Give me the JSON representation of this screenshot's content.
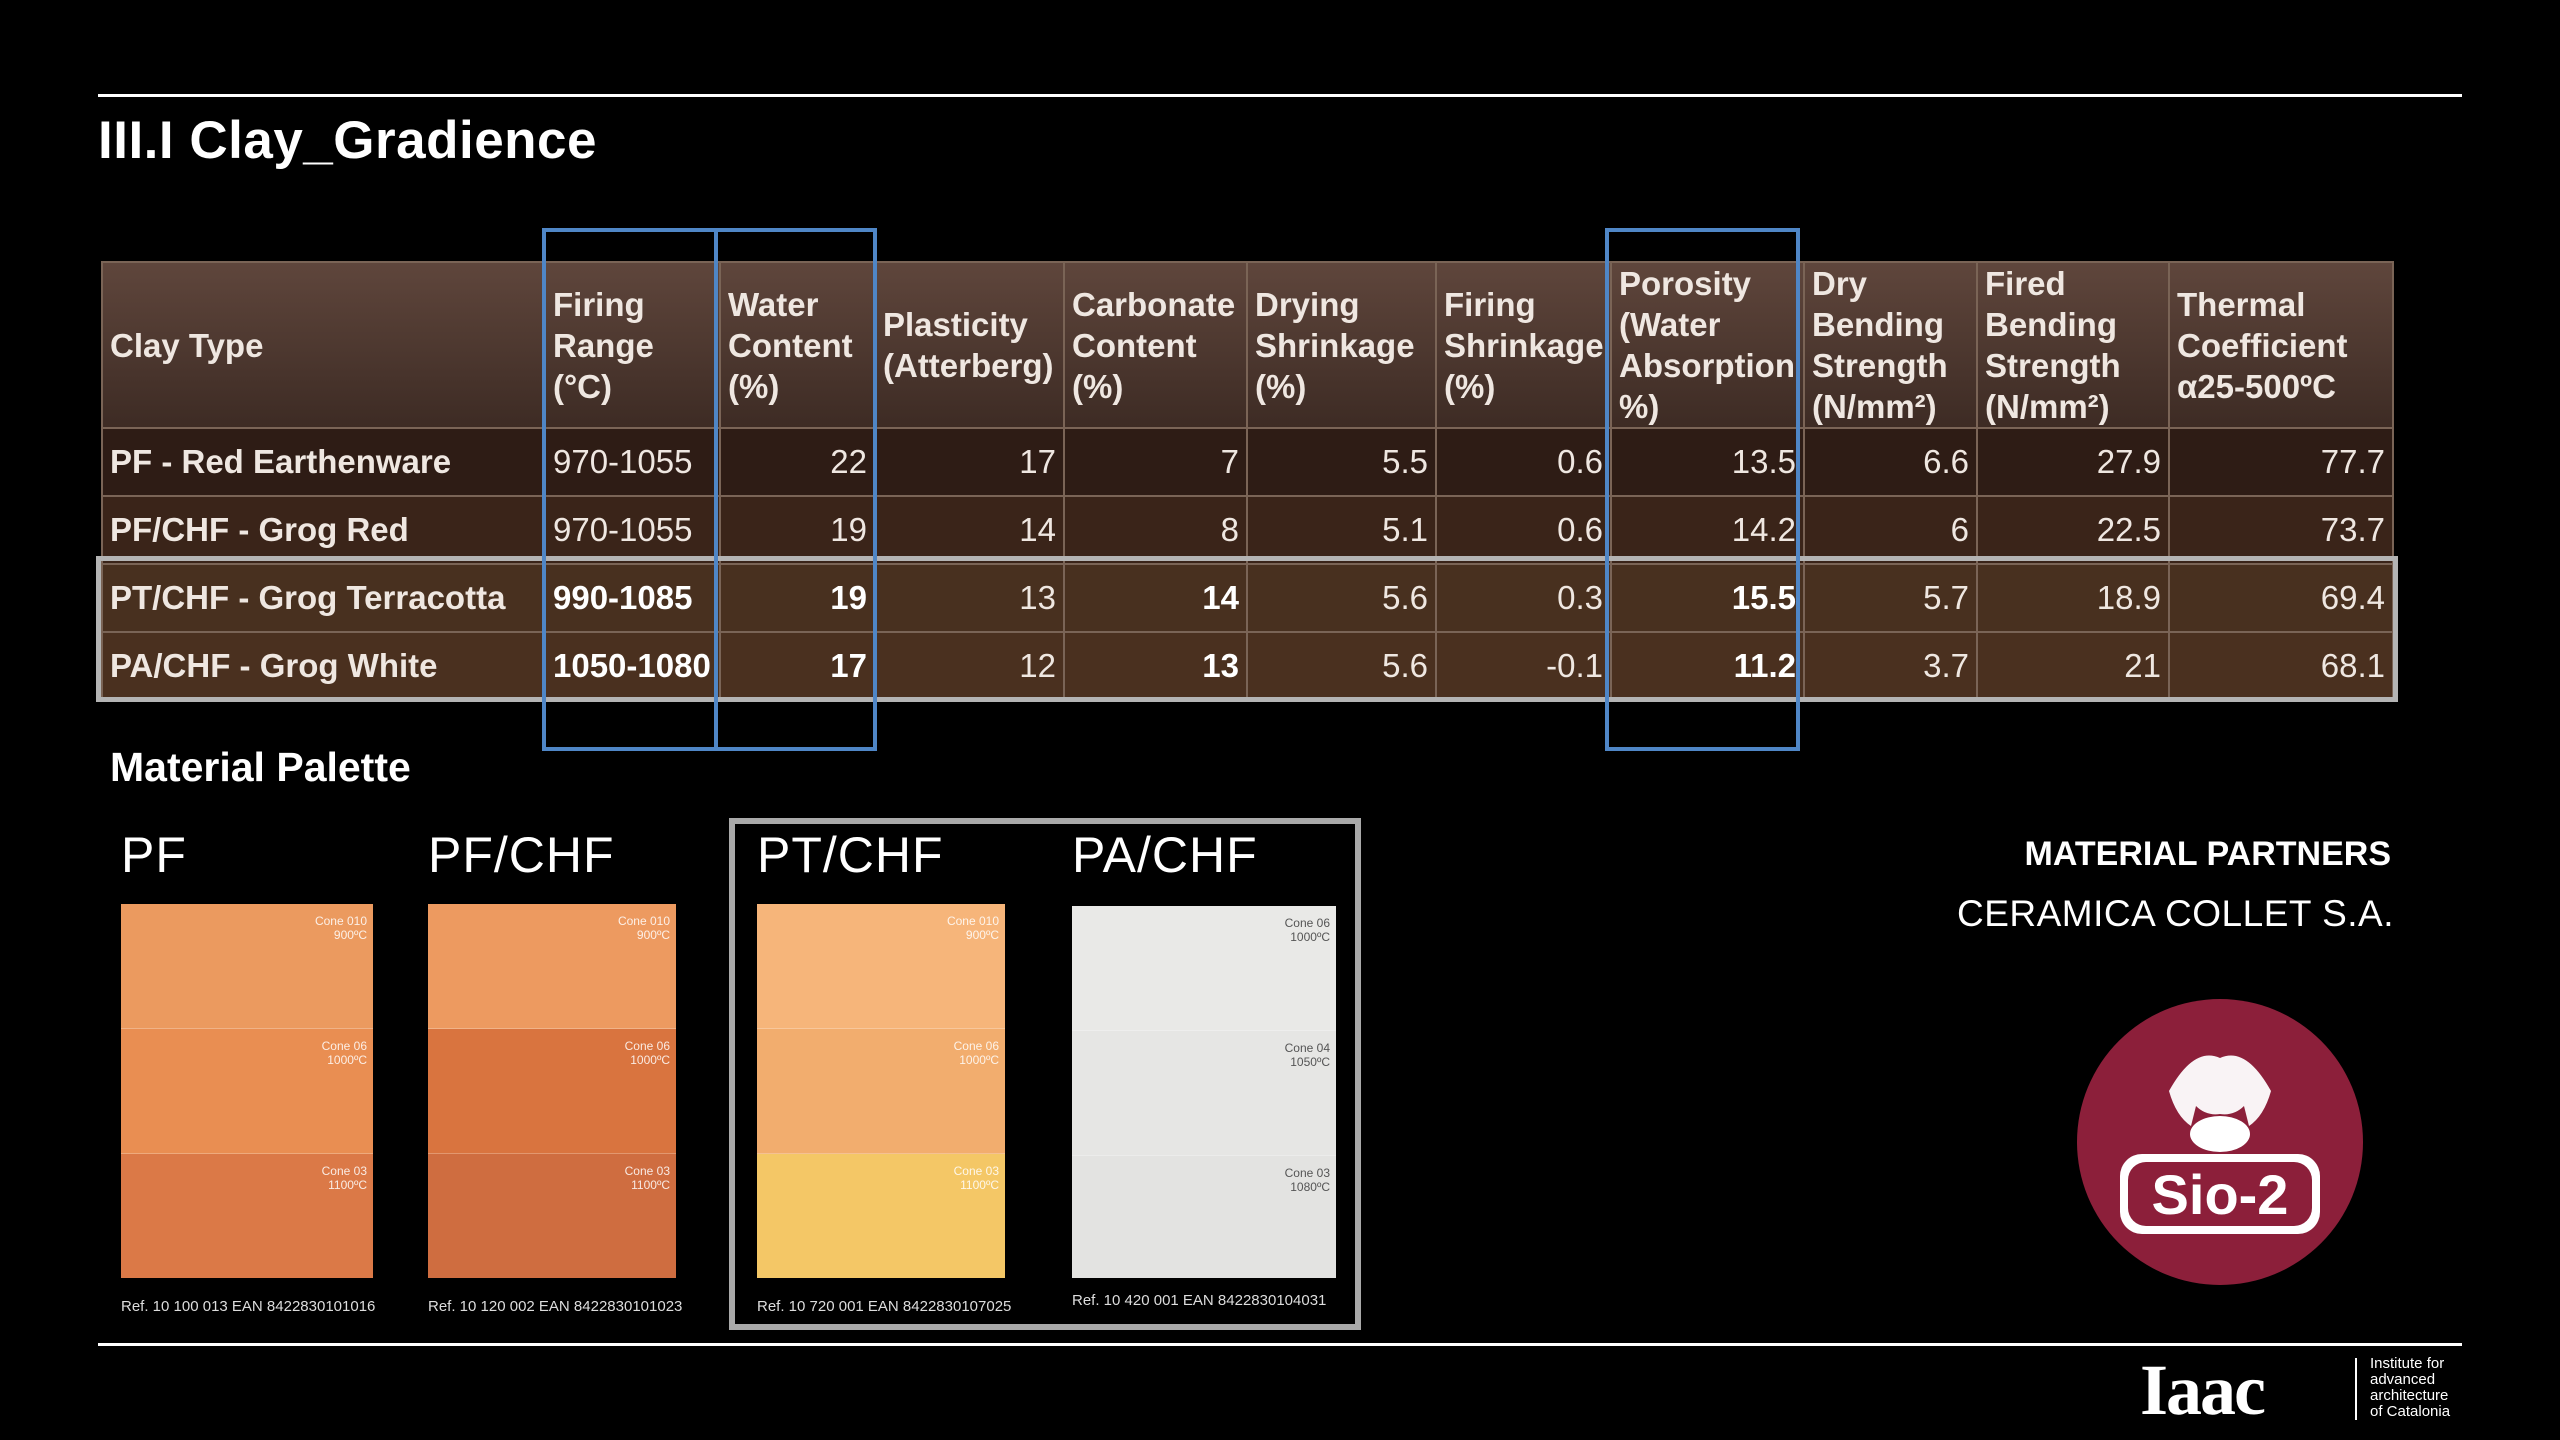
{
  "title": "III.I Clay_Gradience",
  "table": {
    "headers": [
      "Clay Type",
      "Firing Range (°C)",
      "Water Content (%)",
      "Plasticity (Atterberg)",
      "Carbonate Content (%)",
      "Drying Shrinkage (%)",
      "Firing Shrinkage (%)",
      "Porosity (Water Absorption %)",
      "Dry Bending Strength (N/mm²)",
      "Fired Bending Strength (N/mm²)",
      "Thermal Coefficient α25-500ºC"
    ],
    "rows": [
      [
        "PF - Red Earthenware",
        "970-1055",
        "22",
        "17",
        "7",
        "5.5",
        "0.6",
        "13.5",
        "6.6",
        "27.9",
        "77.7"
      ],
      [
        "PF/CHF - Grog Red",
        "970-1055",
        "19",
        "14",
        "8",
        "5.1",
        "0.6",
        "14.2",
        "6",
        "22.5",
        "73.7"
      ],
      [
        "PT/CHF - Grog Terracotta",
        "990-1085",
        "19",
        "13",
        "14",
        "5.6",
        "0.3",
        "15.5",
        "5.7",
        "18.9",
        "69.4"
      ],
      [
        "PA/CHF - Grog White",
        "1050-1080",
        "17",
        "12",
        "13",
        "5.6",
        "-0.1",
        "11.2",
        "3.7",
        "21",
        "68.1"
      ]
    ]
  },
  "palette": {
    "title": "Material Palette",
    "materials": [
      {
        "label": "PF",
        "ref": "Ref. 10 100 013   EAN 8422830101016",
        "swatches": [
          {
            "cone": "Cone 010",
            "temp": "900ºC",
            "color": "#eb9a5f"
          },
          {
            "cone": "Cone 06",
            "temp": "1000ºC",
            "color": "#e98e52"
          },
          {
            "cone": "Cone 03",
            "temp": "1100ºC",
            "color": "#db7947"
          }
        ]
      },
      {
        "label": "PF/CHF",
        "ref": "Ref. 10 120 002   EAN 8422830101023",
        "swatches": [
          {
            "cone": "Cone 010",
            "temp": "900ºC",
            "color": "#ed9a60"
          },
          {
            "cone": "Cone 06",
            "temp": "1000ºC",
            "color": "#d9743f"
          },
          {
            "cone": "Cone 03",
            "temp": "1100ºC",
            "color": "#cf6d40"
          }
        ]
      },
      {
        "label": "PT/CHF",
        "ref": "Ref. 10 720 001   EAN 8422830107025",
        "swatches": [
          {
            "cone": "Cone 010",
            "temp": "900ºC",
            "color": "#f6b57a"
          },
          {
            "cone": "Cone 06",
            "temp": "1000ºC",
            "color": "#f2ad6e"
          },
          {
            "cone": "Cone 03",
            "temp": "1100ºC",
            "color": "#f4c766"
          }
        ]
      },
      {
        "label": "PA/CHF",
        "ref": "Ref. 10 420 001   EAN 8422830104031",
        "swatches": [
          {
            "cone": "Cone 06",
            "temp": "1000ºC",
            "color": "#e9e9e7"
          },
          {
            "cone": "Cone 04",
            "temp": "1050ºC",
            "color": "#e6e6e4"
          },
          {
            "cone": "Cone 03",
            "temp": "1080ºC",
            "color": "#e3e3e1"
          }
        ]
      }
    ]
  },
  "partners": {
    "heading": "MATERIAL PARTNERS",
    "name": "CERAMICA COLLET S.A.",
    "logo_text": "Sio-2",
    "logo_color": "#8c1f3a"
  },
  "footer": {
    "logo_word": "Iaac",
    "institute": [
      "Institute for",
      "advanced",
      "architecture",
      "of Catalonia"
    ]
  },
  "colors": {
    "highlight_columns": "#4f86c6",
    "highlight_rows": "#b4b4b4"
  }
}
